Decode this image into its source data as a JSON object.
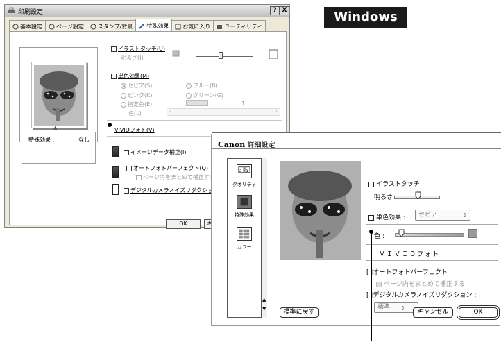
{
  "windows_dialog": {
    "title": "印刷設定",
    "help_btn": "?",
    "close_btn": "X",
    "tabs": [
      {
        "label": "基本設定",
        "active": false
      },
      {
        "label": "ページ設定",
        "active": false
      },
      {
        "label": "スタンプ/背景",
        "active": false
      },
      {
        "label": "特殊効果",
        "active": true
      },
      {
        "label": "お気に入り",
        "active": false
      },
      {
        "label": "ユーティリティ",
        "active": false
      }
    ],
    "illustration_touch": "イラストタッチ(U)",
    "brightness": "明るさ(I)",
    "monochrome_effect": "単色効果(M)",
    "color_options": [
      "セピア(S)",
      "ブルー(B)",
      "ピンク(K)",
      "グリーン(G)",
      "指定色(E)"
    ],
    "color_label": "色(L)",
    "color_value": "1",
    "vivid_photo": "VIVIDフォト(V)",
    "image_data_correction": "イメージデータ補正(I)",
    "auto_photo_perfect": "オートフォトパーフェクト(Q)",
    "page_batch_correction": "ページ内をまとめて補正する(T)",
    "digital_camera_nr": "デジタルカメラノイズリダクション(R)",
    "effect_label": "特殊効果 :",
    "effect_value": "なし",
    "ok_label": "OK",
    "cancel_label": "キ"
  },
  "badge": {
    "text": "Windows"
  },
  "mac_dialog": {
    "logo": "Canon",
    "title": "詳細設定",
    "sidebar": [
      {
        "label": "クオリティ",
        "icon": "quality-icon"
      },
      {
        "label": "特殊効果",
        "icon": "special-effects-icon"
      },
      {
        "label": "カラー",
        "icon": "color-icon"
      }
    ],
    "illustration_touch": "イラストタッチ",
    "brightness": "明るさ :",
    "monochrome_effect": "単色効果 :",
    "monochrome_value": "セピア",
    "color_label": "色 :",
    "vivid_photo": "ＶＩＶＩＤフォト",
    "auto_photo_perfect": "オートフォトパーフェクト",
    "page_batch_correction": "ページ内をまとめて補正する",
    "digital_camera_nr": "デジタルカメラノイズリダクション :",
    "nr_level": "標準",
    "reset_btn": "標準に戻す",
    "cancel_btn": "キャンセル",
    "ok_btn": "OK"
  },
  "colors": {
    "accent": "#1a1a1a",
    "panel": "#ece9d8",
    "swatch": "#9a9a9a"
  }
}
